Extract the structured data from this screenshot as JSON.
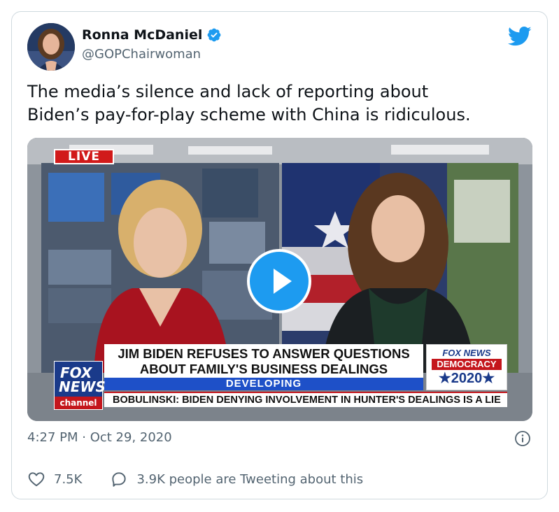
{
  "author": {
    "name": "Ronna McDaniel",
    "handle": "@GOPChairwoman",
    "verified": true,
    "avatar": "avatar"
  },
  "brand_icon": "twitter-bird-icon",
  "tweet": {
    "text_line1": "The media’s silence and lack of reporting about",
    "text_line2": "Biden’s pay-for-play scheme with China is ridiculous."
  },
  "video": {
    "live_label": "LIVE",
    "play_icon": "play-icon",
    "network_logo": {
      "line1": "FOX",
      "line2": "NEWS",
      "line3": "channel"
    },
    "headline_line1": "JIM BIDEN REFUSES TO ANSWER QUESTIONS",
    "headline_line2": "ABOUT FAMILY'S BUSINESS DEALINGS",
    "banner": "DEVELOPING",
    "ticker": "BOBULINSKI: BIDEN DENYING INVOLVEMENT IN HUNTER'S DEALINGS IS A LIE",
    "election_badge": {
      "line1": "FOX NEWS",
      "line2": "DEMOCRACY",
      "line3": "★2020★"
    }
  },
  "timestamp": "4:27 PM · Oct 29, 2020",
  "actions": {
    "likes": "7.5K",
    "replies_text": "3.9K people are Tweeting about this"
  },
  "colors": {
    "accent": "#1d9bf0",
    "secondary_text": "#536471",
    "fox_red": "#c4161c",
    "fox_blue": "#1a3a8a"
  }
}
